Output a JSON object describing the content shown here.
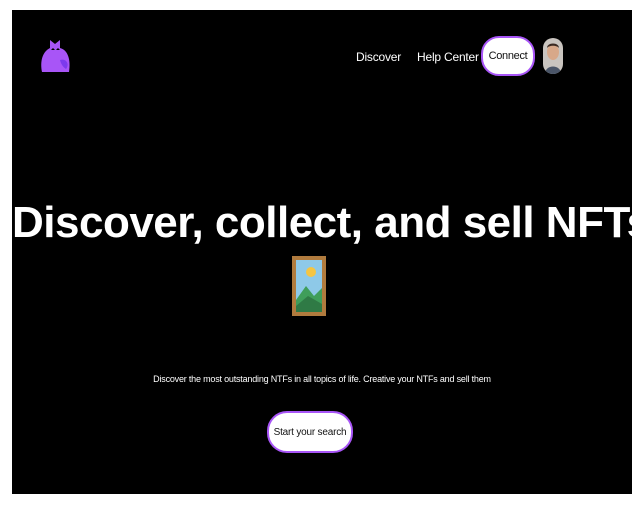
{
  "colors": {
    "background": "#000000",
    "accent": "#a855f7",
    "text": "#ffffff",
    "button_bg": "#ffffff",
    "button_text": "#111111"
  },
  "header": {
    "logo_icon": "cat-logo-icon",
    "nav": [
      {
        "label": "Discover"
      },
      {
        "label": "Help Center"
      }
    ],
    "connect_label": "Connect",
    "avatar_icon": "user-avatar"
  },
  "hero": {
    "title": "Discover, collect, and sell NFTs",
    "image_icon": "framed-landscape-picture-icon",
    "subtitle": "Discover the most outstanding NTFs in all topics of life. Creative your NTFs and sell them",
    "cta_label": "Start your search"
  }
}
